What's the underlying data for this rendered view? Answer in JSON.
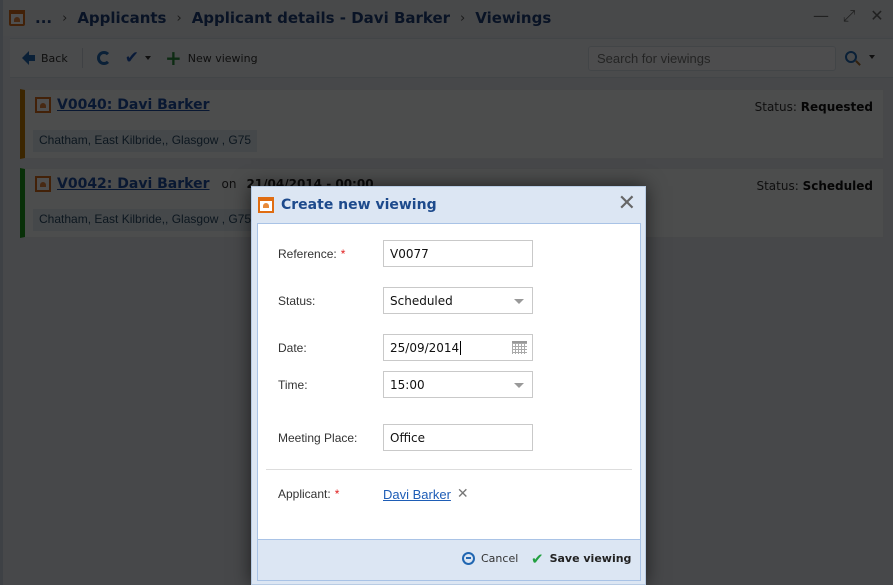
{
  "window": {
    "breadcrumb": [
      "...",
      "Applicants",
      "Applicant details - Davi Barker",
      "Viewings"
    ],
    "controls": {
      "minimize": "—",
      "maximize": "⤢",
      "close": "✕"
    }
  },
  "toolbar": {
    "back_label": "Back",
    "new_viewing_label": "New viewing",
    "search_placeholder": "Search for viewings"
  },
  "viewings": [
    {
      "title": "V0040: Davi Barker",
      "on_label": "",
      "date": "",
      "status_label": "Status:",
      "status": "Requested",
      "address": "Chatham, East Kilbride,, Glasgow , G75",
      "color": "#c27a00"
    },
    {
      "title": "V0042: Davi Barker",
      "on_label": "on",
      "date": "21/04/2014 - 00:00",
      "status_label": "Status:",
      "status": "Scheduled",
      "address": "Chatham, East Kilbride,, Glasgow , G75",
      "color": "#1b9a1b"
    }
  ],
  "dialog": {
    "title": "Create new viewing",
    "close": "✕",
    "fields": {
      "reference": {
        "label": "Reference:",
        "required": "*",
        "value": "V0077"
      },
      "status": {
        "label": "Status:",
        "value": "Scheduled"
      },
      "date": {
        "label": "Date:",
        "value": "25/09/2014"
      },
      "time": {
        "label": "Time:",
        "value": "15:00"
      },
      "meeting_place": {
        "label": "Meeting Place:",
        "value": "Office"
      },
      "applicant": {
        "label": "Applicant:",
        "required": "*",
        "value": "Davi Barker",
        "remove": "✕"
      }
    },
    "buttons": {
      "cancel": "Cancel",
      "save": "Save viewing"
    }
  }
}
